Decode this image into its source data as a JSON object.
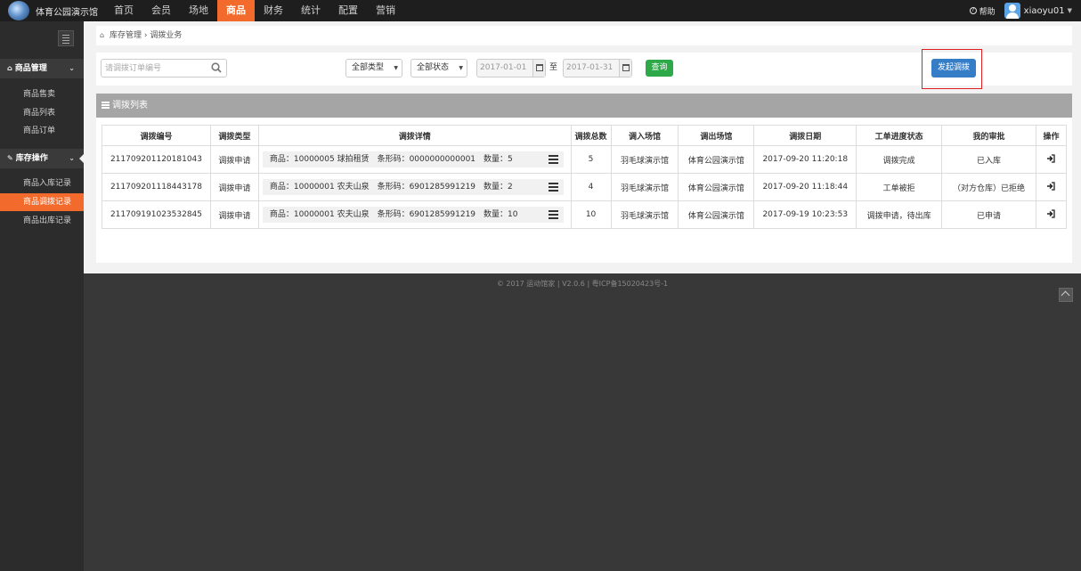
{
  "app": {
    "brand": "体育公园演示馆"
  },
  "nav": {
    "items": [
      {
        "label": "首页"
      },
      {
        "label": "会员"
      },
      {
        "label": "场地"
      },
      {
        "label": "商品"
      },
      {
        "label": "财务"
      },
      {
        "label": "统计"
      },
      {
        "label": "配置"
      },
      {
        "label": "营销"
      }
    ],
    "active": "商品"
  },
  "user": {
    "help_label": "帮助",
    "name": "xiaoyu01",
    "help_icon": "question-circle-icon",
    "avatar_icon": "user-avatar-icon"
  },
  "sidebar": {
    "groups": [
      {
        "label": "商品管理",
        "icon": "home-icon",
        "items": [
          {
            "label": "商品售卖"
          },
          {
            "label": "商品列表"
          },
          {
            "label": "商品订单"
          }
        ]
      },
      {
        "label": "库存操作",
        "icon": "wrench-icon",
        "items": [
          {
            "label": "商品入库记录"
          },
          {
            "label": "商品调拨记录"
          },
          {
            "label": "商品出库记录"
          }
        ]
      }
    ],
    "active_item": "商品调拨记录"
  },
  "breadcrumb": {
    "parent": "库存管理",
    "separator": "›",
    "current": "调拨业务"
  },
  "toolbar": {
    "search_placeholder": "请调拨订单编号",
    "type_select": "全部类型",
    "status_select": "全部状态",
    "date_from": "2017-01-01",
    "to_label": "至",
    "date_to": "2017-01-31",
    "query_label": "查询",
    "transfer_label": "发起调拨"
  },
  "panel": {
    "title": "调拨列表"
  },
  "table": {
    "headers": [
      "调拨编号",
      "调拨类型",
      "调拨详情",
      "调拨总数",
      "调入场馆",
      "调出场馆",
      "调拨日期",
      "工单进度状态",
      "我的审批",
      "操作"
    ],
    "rows": [
      {
        "id": "211709201120181043",
        "type": "调拨申请",
        "detail": "商品：10000005 球拍租赁　条形码：0000000000001　数量：5",
        "total": "5",
        "to_venue": "羽毛球演示馆",
        "from_venue": "体育公园演示馆",
        "date": "2017-09-20 11:20:18",
        "progress": "调拨完成",
        "approval": "已入库"
      },
      {
        "id": "211709201118443178",
        "type": "调拨申请",
        "detail": "商品：10000001 农夫山泉　条形码：6901285991219　数量：2",
        "total": "4",
        "to_venue": "羽毛球演示馆",
        "from_venue": "体育公园演示馆",
        "date": "2017-09-20 11:18:44",
        "progress": "工单被拒",
        "approval": "（对方仓库）已拒绝"
      },
      {
        "id": "211709191023532845",
        "type": "调拨申请",
        "detail": "商品：10000001 农夫山泉　条形码：6901285991219　数量：10",
        "total": "10",
        "to_venue": "羽毛球演示馆",
        "from_venue": "体育公园演示馆",
        "date": "2017-09-19 10:23:53",
        "progress": "调拨申请，待出库",
        "approval": "已申请"
      }
    ]
  },
  "footer": {
    "text": "© 2017 运动馆家 | V2.0.6 | 粤ICP备15020423号-1"
  },
  "colors": {
    "accent": "#f26b2d",
    "topbar": "#1e1e1e",
    "sidebar": "#2c2c2c",
    "query_button": "#2ea94a",
    "primary_button": "#357dc6",
    "highlight_box": "#e02020"
  }
}
